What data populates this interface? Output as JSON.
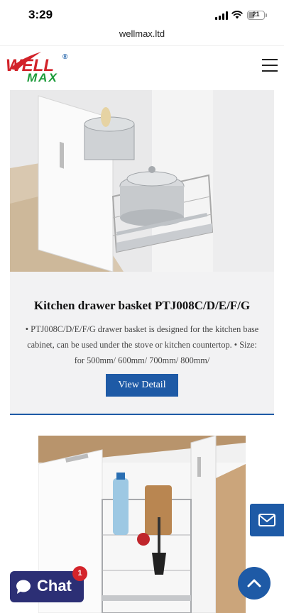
{
  "status_bar": {
    "time": "3:29",
    "battery_level": "21"
  },
  "browser": {
    "url": "wellmax.ltd"
  },
  "header": {
    "logo_top": "WELL",
    "logo_bottom": "MAX",
    "logo_mark": "®",
    "menu_icon": "hamburger-menu-icon"
  },
  "products": [
    {
      "title": "Kitchen drawer basket PTJ008C/D/E/F/G",
      "description": "• PTJ008C/D/E/F/G drawer basket is designed for the kitchen base cabinet, can be used under the stove or kitchen countertop. • Size: for 500mm/ 600mm/ 700mm/ 800mm/",
      "button_label": "View Detail"
    }
  ],
  "floating": {
    "chat_label": "Chat",
    "chat_badge": "1",
    "mail_icon": "envelope-icon",
    "scroll_top_icon": "chevron-up-icon"
  },
  "colors": {
    "accent": "#1e5aa6",
    "chat_bg": "#2c2f75",
    "badge": "#d4242b",
    "logo_red": "#d2232a",
    "logo_green": "#1c9b3a"
  }
}
